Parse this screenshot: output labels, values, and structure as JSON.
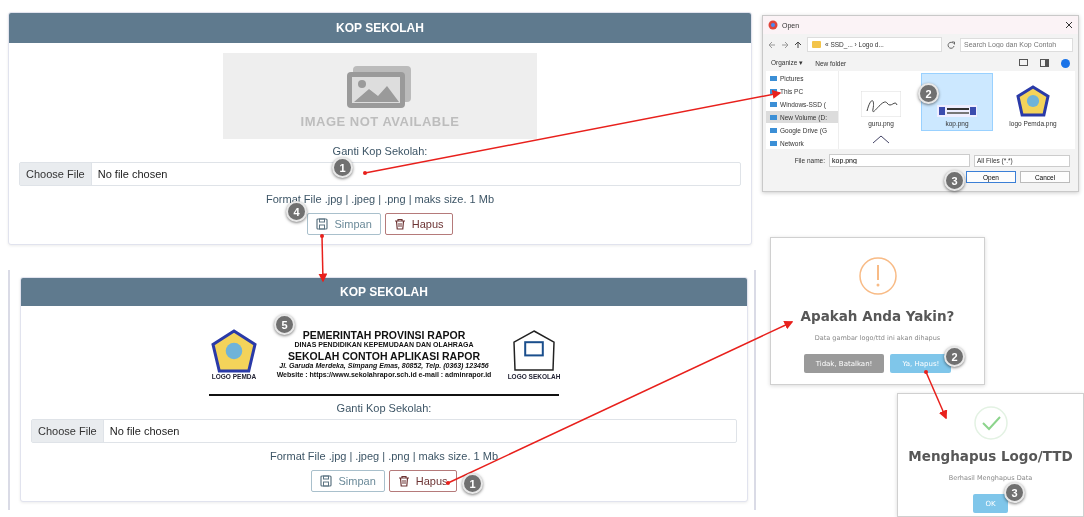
{
  "panels": [
    {
      "title": "KOP SEKOLAH",
      "image": {
        "kind": "placeholder",
        "caption": "IMAGE NOT AVAILABLE"
      },
      "field_label": "Ganti Kop Sekolah:",
      "file_input": {
        "button": "Choose File",
        "value": "No file chosen"
      },
      "hint": "Format File .jpg | .jpeg | .png | maks size. 1 Mb",
      "buttons": [
        {
          "label": "Simpan",
          "kind": "save"
        },
        {
          "label": "Hapus",
          "kind": "delete"
        }
      ]
    },
    {
      "title": "KOP SEKOLAH",
      "image": {
        "kind": "letterhead",
        "lines": [
          "PEMERINTAH PROVINSI RAPOR",
          "DINAS PENDIDIKAN KEPEMUDAAN DAN OLAHRAGA",
          "SEKOLAH CONTOH APLIKASI RAPOR",
          "Jl. Garuda Merdeka, Simpang Emas, 80852, Telp. (0363) 123456",
          "Website : https://www.sekolahrapor.sch.id   e-mail : adminrapor.id"
        ],
        "left_logo": "LOGO PEMDA",
        "right_logo": "LOGO SEKOLAH"
      },
      "field_label": "Ganti Kop Sekolah:",
      "file_input": {
        "button": "Choose File",
        "value": "No file chosen"
      },
      "hint": "Format File .jpg | .jpeg | .png | maks size. 1 Mb",
      "buttons": [
        {
          "label": "Simpan",
          "kind": "save"
        },
        {
          "label": "Hapus",
          "kind": "delete"
        }
      ]
    }
  ],
  "open_dialog": {
    "title": "Open",
    "path": "« SSD_... › Logo d...",
    "search": {
      "placeholder": "Search Logo dan Kop Contoh"
    },
    "toolbar": [
      "Organize ▾",
      "New folder"
    ],
    "nav": [
      {
        "label": "Pictures",
        "selected": false
      },
      {
        "label": "This PC",
        "selected": false
      },
      {
        "label": "Windows-SSD (",
        "selected": false
      },
      {
        "label": "New Volume (D:",
        "selected": true
      },
      {
        "label": "Google Drive (G",
        "selected": false
      },
      {
        "label": "Network",
        "selected": false
      }
    ],
    "files": [
      {
        "name": "guru.png",
        "kind": "signature",
        "selected": false
      },
      {
        "name": "kop.png",
        "kind": "letterhead",
        "selected": true
      },
      {
        "name": "logo Pemda.png",
        "kind": "emblem",
        "selected": false
      },
      {
        "kind": "partial",
        "selected": false
      }
    ],
    "file_name_label": "File name:",
    "file_name": "kop.png",
    "file_type": "All Files (*.*)",
    "buttons": [
      {
        "label": "Open",
        "kind": "primary"
      },
      {
        "label": "Cancel",
        "kind": "secondary"
      }
    ]
  },
  "confirm_dialog": {
    "title": "Apakah Anda Yakin?",
    "text": "Data gambar logo/ttd ini akan dihapus",
    "buttons": [
      {
        "label": "Tidak, Batalkan!",
        "kind": "cancel"
      },
      {
        "label": "Ya, Hapus!",
        "kind": "confirm"
      }
    ]
  },
  "success_dialog": {
    "title": "Menghapus Logo/TTD",
    "text": "Berhasil Menghapus Data",
    "buttons": [
      {
        "label": "OK",
        "kind": "confirm"
      }
    ]
  },
  "step_markers": [
    {
      "number": "1"
    },
    {
      "number": "4"
    },
    {
      "number": "5"
    },
    {
      "number": "1"
    },
    {
      "number": "2"
    },
    {
      "number": "3"
    },
    {
      "number": "2"
    },
    {
      "number": "3"
    }
  ]
}
